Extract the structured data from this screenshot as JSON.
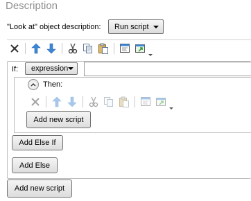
{
  "header": {
    "title": "Description"
  },
  "description_row": {
    "label": "\"Look at\" object description:",
    "dropdown_value": "Run script"
  },
  "if_block": {
    "if_label": "If:",
    "condition_type": "expression",
    "expression_value": "",
    "then_label": "Then:",
    "then_add_script_label": "Add new script",
    "add_else_if_label": "Add Else If",
    "add_else_label": "Add Else"
  },
  "footer": {
    "add_script_label": "Add new script"
  },
  "colors": {
    "title": "#8f8f8f",
    "arrow_blue": "#3d86d6",
    "delete_x": "#444444",
    "border": "#bdbdbd"
  },
  "toolbar_icons": [
    "delete-icon",
    "move-up-icon",
    "move-down-icon",
    "cut-icon",
    "copy-icon",
    "paste-icon",
    "code-view-icon",
    "popout-icon"
  ]
}
